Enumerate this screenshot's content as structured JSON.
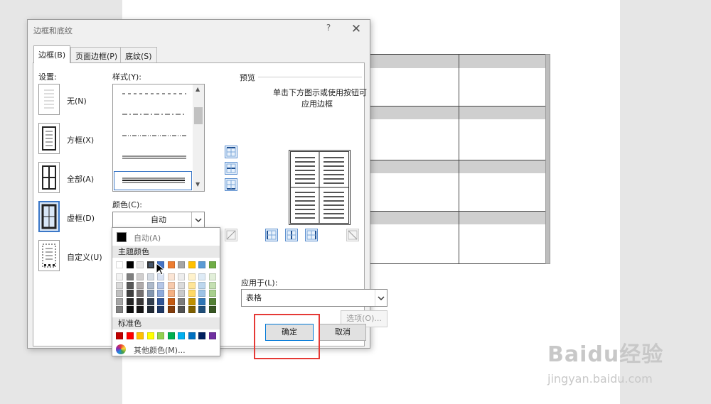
{
  "dialog": {
    "title": "边框和底纹",
    "help": "?",
    "close": "✕",
    "tabs": [
      {
        "label": "边框(B)",
        "active": true
      },
      {
        "label": "页面边框(P)",
        "active": false
      },
      {
        "label": "底纹(S)",
        "active": false
      }
    ],
    "settings_label": "设置:",
    "settings": [
      {
        "label": "无(N)",
        "selected": false
      },
      {
        "label": "方框(X)",
        "selected": false
      },
      {
        "label": "全部(A)",
        "selected": false
      },
      {
        "label": "虚框(D)",
        "selected": true
      },
      {
        "label": "自定义(U)",
        "selected": false
      }
    ],
    "style_label": "样式(Y):",
    "color_label": "颜色(C):",
    "color_value": "自动",
    "color_popup": {
      "auto_label": "自动(A)",
      "theme_label": "主题颜色",
      "standard_label": "标准色",
      "more_label": "其他颜色(M)...",
      "theme_top": [
        "#ffffff",
        "#000000",
        "#e7e6e6",
        "#44546a",
        "#4472c4",
        "#ed7d31",
        "#a5a5a5",
        "#ffc000",
        "#5b9bd5",
        "#70ad47"
      ],
      "theme_shades": [
        [
          "#f2f2f2",
          "#d9d9d9",
          "#bfbfbf",
          "#a6a6a6",
          "#808080"
        ],
        [
          "#7f7f7f",
          "#595959",
          "#404040",
          "#262626",
          "#0d0d0d"
        ],
        [
          "#d0cece",
          "#afabab",
          "#757171",
          "#3a3838",
          "#171616"
        ],
        [
          "#d6dce4",
          "#adb9ca",
          "#8497b0",
          "#333f4f",
          "#222a35"
        ],
        [
          "#d9e2f3",
          "#b4c6e7",
          "#8eaadb",
          "#2f5496",
          "#1f3864"
        ],
        [
          "#fbe5d5",
          "#f7caac",
          "#f4b183",
          "#c55a11",
          "#833c0b"
        ],
        [
          "#ededed",
          "#dbdbdb",
          "#c9c9c9",
          "#7b7b7b",
          "#525252"
        ],
        [
          "#fff2cc",
          "#ffe598",
          "#ffd965",
          "#bf9000",
          "#7f6000"
        ],
        [
          "#deebf6",
          "#bdd7ee",
          "#9cc3e5",
          "#2e75b5",
          "#1f4e79"
        ],
        [
          "#e2efd9",
          "#c5e0b3",
          "#a8d08d",
          "#538135",
          "#375623"
        ]
      ],
      "standard": [
        "#c00000",
        "#ff0000",
        "#ffc000",
        "#ffff00",
        "#92d050",
        "#00b050",
        "#00b0f0",
        "#0070c0",
        "#002060",
        "#7030a0"
      ]
    },
    "preview_label": "预览",
    "preview_hint_line1": "单击下方图示或使用按钮可",
    "preview_hint_line2": "应用边框",
    "apply_label": "应用于(L):",
    "apply_value": "表格",
    "options_button": "选项(O)...",
    "ok_button": "确定",
    "cancel_button": "取消"
  },
  "watermark": {
    "logo": "Baidu经验",
    "url": "jingyan.baidu.com"
  },
  "colors": {
    "accent": "#3a77c7",
    "highlight": "#e53935"
  }
}
